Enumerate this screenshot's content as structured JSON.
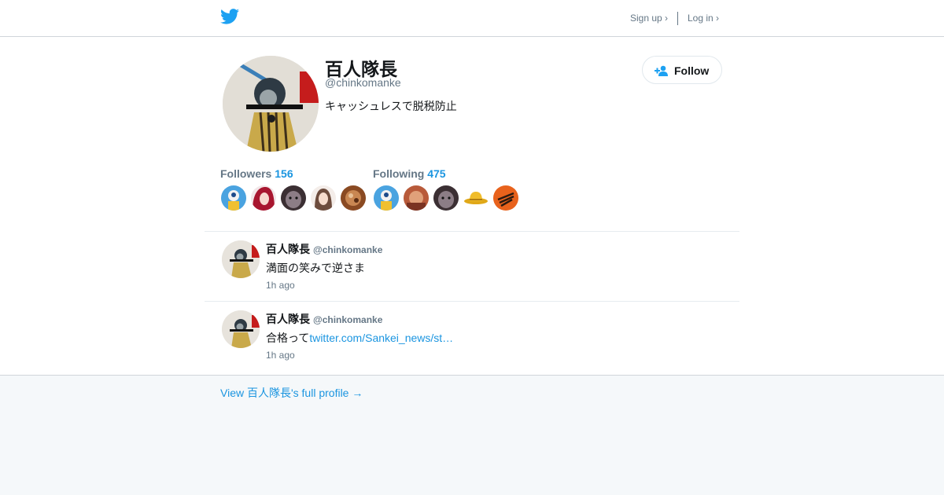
{
  "nav": {
    "signup": "Sign up ›",
    "login": "Log in ›"
  },
  "profile": {
    "name": "百人隊長",
    "handle": "@chinkomanke",
    "bio": "キャッシュレスで脱税防止",
    "follow_label": "Follow"
  },
  "stats": {
    "followers_label": "Followers",
    "followers_count": "156",
    "following_label": "Following",
    "following_count": "475"
  },
  "tweets": [
    {
      "name": "百人隊長",
      "handle": "@chinkomanke",
      "text": "満面の笑みで逆さま",
      "link": "",
      "time": "1h ago"
    },
    {
      "name": "百人隊長",
      "handle": "@chinkomanke",
      "text": "合格って",
      "link": "twitter.com/Sankei_news/st…",
      "time": "1h ago"
    }
  ],
  "footer": {
    "full_profile": "View 百人隊長's full profile →"
  },
  "colors": {
    "accent": "#1b95e0",
    "twitter_blue": "#1da1f2",
    "muted": "#657786",
    "page_bg": "#f5f8fa"
  }
}
